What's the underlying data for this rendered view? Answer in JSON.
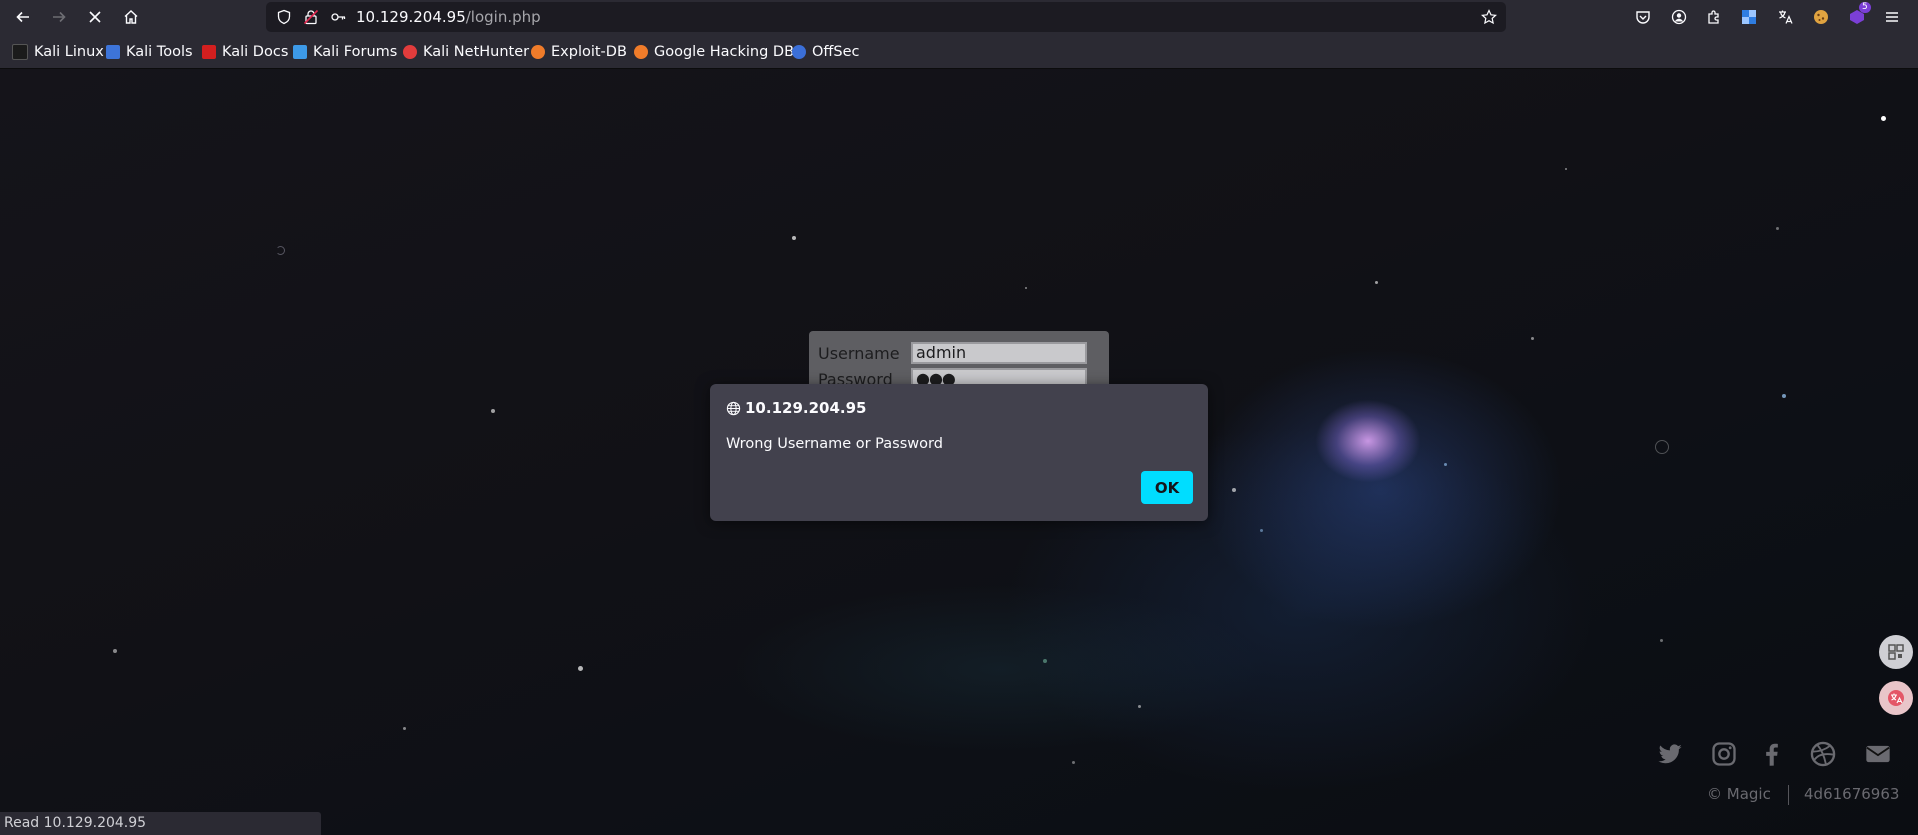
{
  "browser": {
    "url_host": "10.129.204.95",
    "url_path": "/login.php",
    "extensions_badge": "5"
  },
  "bookmarks": [
    {
      "label": "Kali Linux",
      "icon": "kali-dragon-icon",
      "color": "#1b1b1b"
    },
    {
      "label": "Kali Tools",
      "icon": "kali-tools-icon",
      "color": "#3d74d9"
    },
    {
      "label": "Kali Docs",
      "icon": "kali-docs-icon",
      "color": "#d31f1f"
    },
    {
      "label": "Kali Forums",
      "icon": "kali-forums-icon",
      "color": "#3d9ae8"
    },
    {
      "label": "Kali NetHunter",
      "icon": "nethunter-icon",
      "color": "#e23c3c"
    },
    {
      "label": "Exploit-DB",
      "icon": "exploit-db-icon",
      "color": "#f07c2a"
    },
    {
      "label": "Google Hacking DB",
      "icon": "ghdb-icon",
      "color": "#f07c2a"
    },
    {
      "label": "OffSec",
      "icon": "offsec-icon",
      "color": "#3b6fd8"
    }
  ],
  "login": {
    "username_label": "Username",
    "username_value": "admin",
    "password_label": "Password",
    "password_value": "●●●"
  },
  "dialog": {
    "title": "10.129.204.95",
    "message": "Wrong Username or Password",
    "ok_label": "OK"
  },
  "footer": {
    "copyright": "© Magic",
    "code": "4d61676963"
  },
  "status_bar": {
    "text": "Read 10.129.204.95"
  },
  "colors": {
    "accent": "#00ddff",
    "chrome": "#2b2a33",
    "dialog_bg": "#42414d"
  }
}
